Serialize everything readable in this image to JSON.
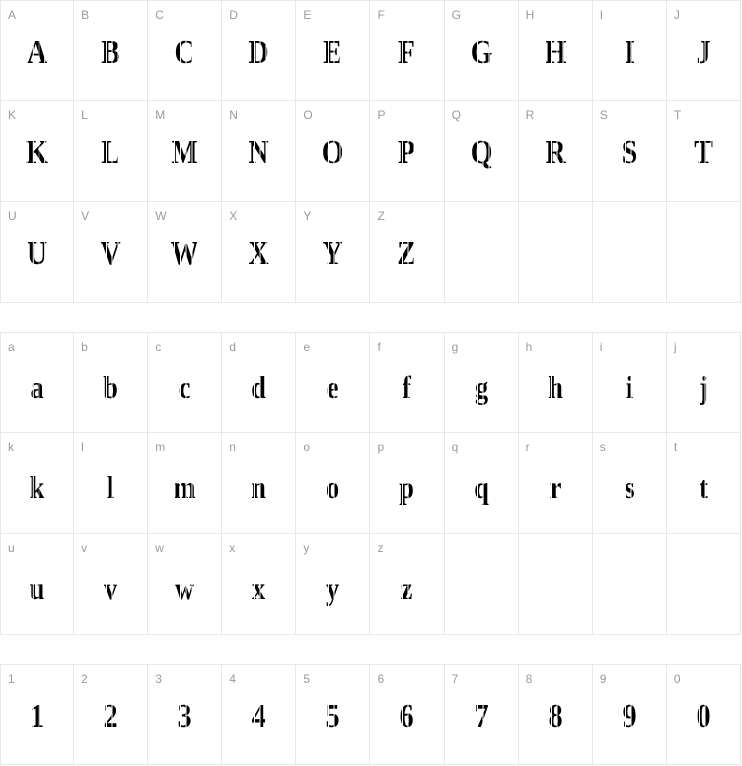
{
  "sections": {
    "uppercase": {
      "cells": [
        {
          "label": "A",
          "glyph": "A"
        },
        {
          "label": "B",
          "glyph": "B"
        },
        {
          "label": "C",
          "glyph": "C"
        },
        {
          "label": "D",
          "glyph": "D"
        },
        {
          "label": "E",
          "glyph": "E"
        },
        {
          "label": "F",
          "glyph": "F"
        },
        {
          "label": "G",
          "glyph": "G"
        },
        {
          "label": "H",
          "glyph": "H"
        },
        {
          "label": "I",
          "glyph": "I"
        },
        {
          "label": "J",
          "glyph": "J"
        },
        {
          "label": "K",
          "glyph": "K"
        },
        {
          "label": "L",
          "glyph": "L"
        },
        {
          "label": "M",
          "glyph": "M"
        },
        {
          "label": "N",
          "glyph": "N"
        },
        {
          "label": "O",
          "glyph": "O"
        },
        {
          "label": "P",
          "glyph": "P"
        },
        {
          "label": "Q",
          "glyph": "Q"
        },
        {
          "label": "R",
          "glyph": "R"
        },
        {
          "label": "S",
          "glyph": "S"
        },
        {
          "label": "T",
          "glyph": "T"
        },
        {
          "label": "U",
          "glyph": "U"
        },
        {
          "label": "V",
          "glyph": "V"
        },
        {
          "label": "W",
          "glyph": "W"
        },
        {
          "label": "X",
          "glyph": "X"
        },
        {
          "label": "Y",
          "glyph": "Y"
        },
        {
          "label": "Z",
          "glyph": "Z"
        }
      ]
    },
    "lowercase": {
      "cells": [
        {
          "label": "a",
          "glyph": "a"
        },
        {
          "label": "b",
          "glyph": "b"
        },
        {
          "label": "c",
          "glyph": "c"
        },
        {
          "label": "d",
          "glyph": "d"
        },
        {
          "label": "e",
          "glyph": "e"
        },
        {
          "label": "f",
          "glyph": "f"
        },
        {
          "label": "g",
          "glyph": "g"
        },
        {
          "label": "h",
          "glyph": "h"
        },
        {
          "label": "i",
          "glyph": "i"
        },
        {
          "label": "j",
          "glyph": "j"
        },
        {
          "label": "k",
          "glyph": "k"
        },
        {
          "label": "l",
          "glyph": "l"
        },
        {
          "label": "m",
          "glyph": "m"
        },
        {
          "label": "n",
          "glyph": "n"
        },
        {
          "label": "o",
          "glyph": "o"
        },
        {
          "label": "p",
          "glyph": "p"
        },
        {
          "label": "q",
          "glyph": "q"
        },
        {
          "label": "r",
          "glyph": "r"
        },
        {
          "label": "s",
          "glyph": "s"
        },
        {
          "label": "t",
          "glyph": "t"
        },
        {
          "label": "u",
          "glyph": "u"
        },
        {
          "label": "v",
          "glyph": "v"
        },
        {
          "label": "w",
          "glyph": "w"
        },
        {
          "label": "x",
          "glyph": "x"
        },
        {
          "label": "y",
          "glyph": "y"
        },
        {
          "label": "z",
          "glyph": "z"
        }
      ]
    },
    "digits": {
      "cells": [
        {
          "label": "1",
          "glyph": "1"
        },
        {
          "label": "2",
          "glyph": "2"
        },
        {
          "label": "3",
          "glyph": "3"
        },
        {
          "label": "4",
          "glyph": "4"
        },
        {
          "label": "5",
          "glyph": "5"
        },
        {
          "label": "6",
          "glyph": "6"
        },
        {
          "label": "7",
          "glyph": "7"
        },
        {
          "label": "8",
          "glyph": "8"
        },
        {
          "label": "9",
          "glyph": "9"
        },
        {
          "label": "0",
          "glyph": "0"
        }
      ]
    }
  },
  "colors": {
    "label": "#9a9a9a",
    "grid_border": "#e8e8e8",
    "glyph": "#000000",
    "background": "#ffffff"
  }
}
